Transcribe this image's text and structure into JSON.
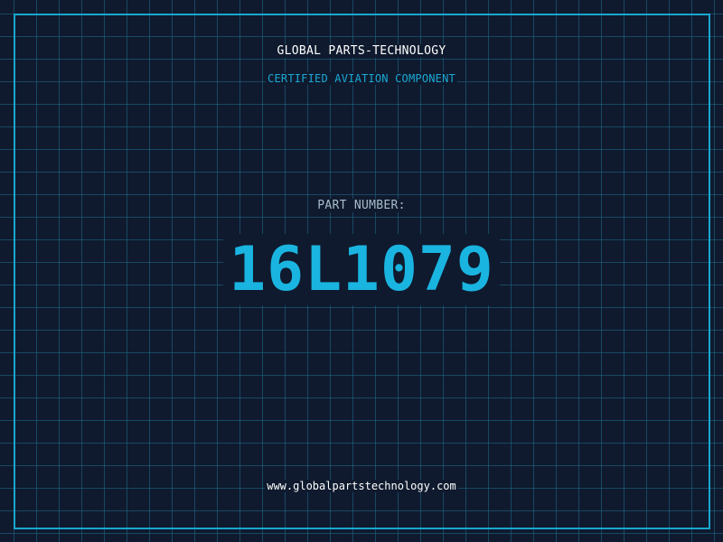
{
  "header": {
    "company_name": "GLOBAL PARTS-TECHNOLOGY",
    "tagline": "CERTIFIED AVIATION COMPONENT"
  },
  "part": {
    "label": "PART NUMBER:",
    "number": "16L1079"
  },
  "footer": {
    "website": "www.globalpartstechnology.com"
  },
  "colors": {
    "background": "#0f1a2e",
    "grid": "#1e6e8c",
    "accent": "#1ab4e0",
    "frame": "#19a7cf"
  }
}
